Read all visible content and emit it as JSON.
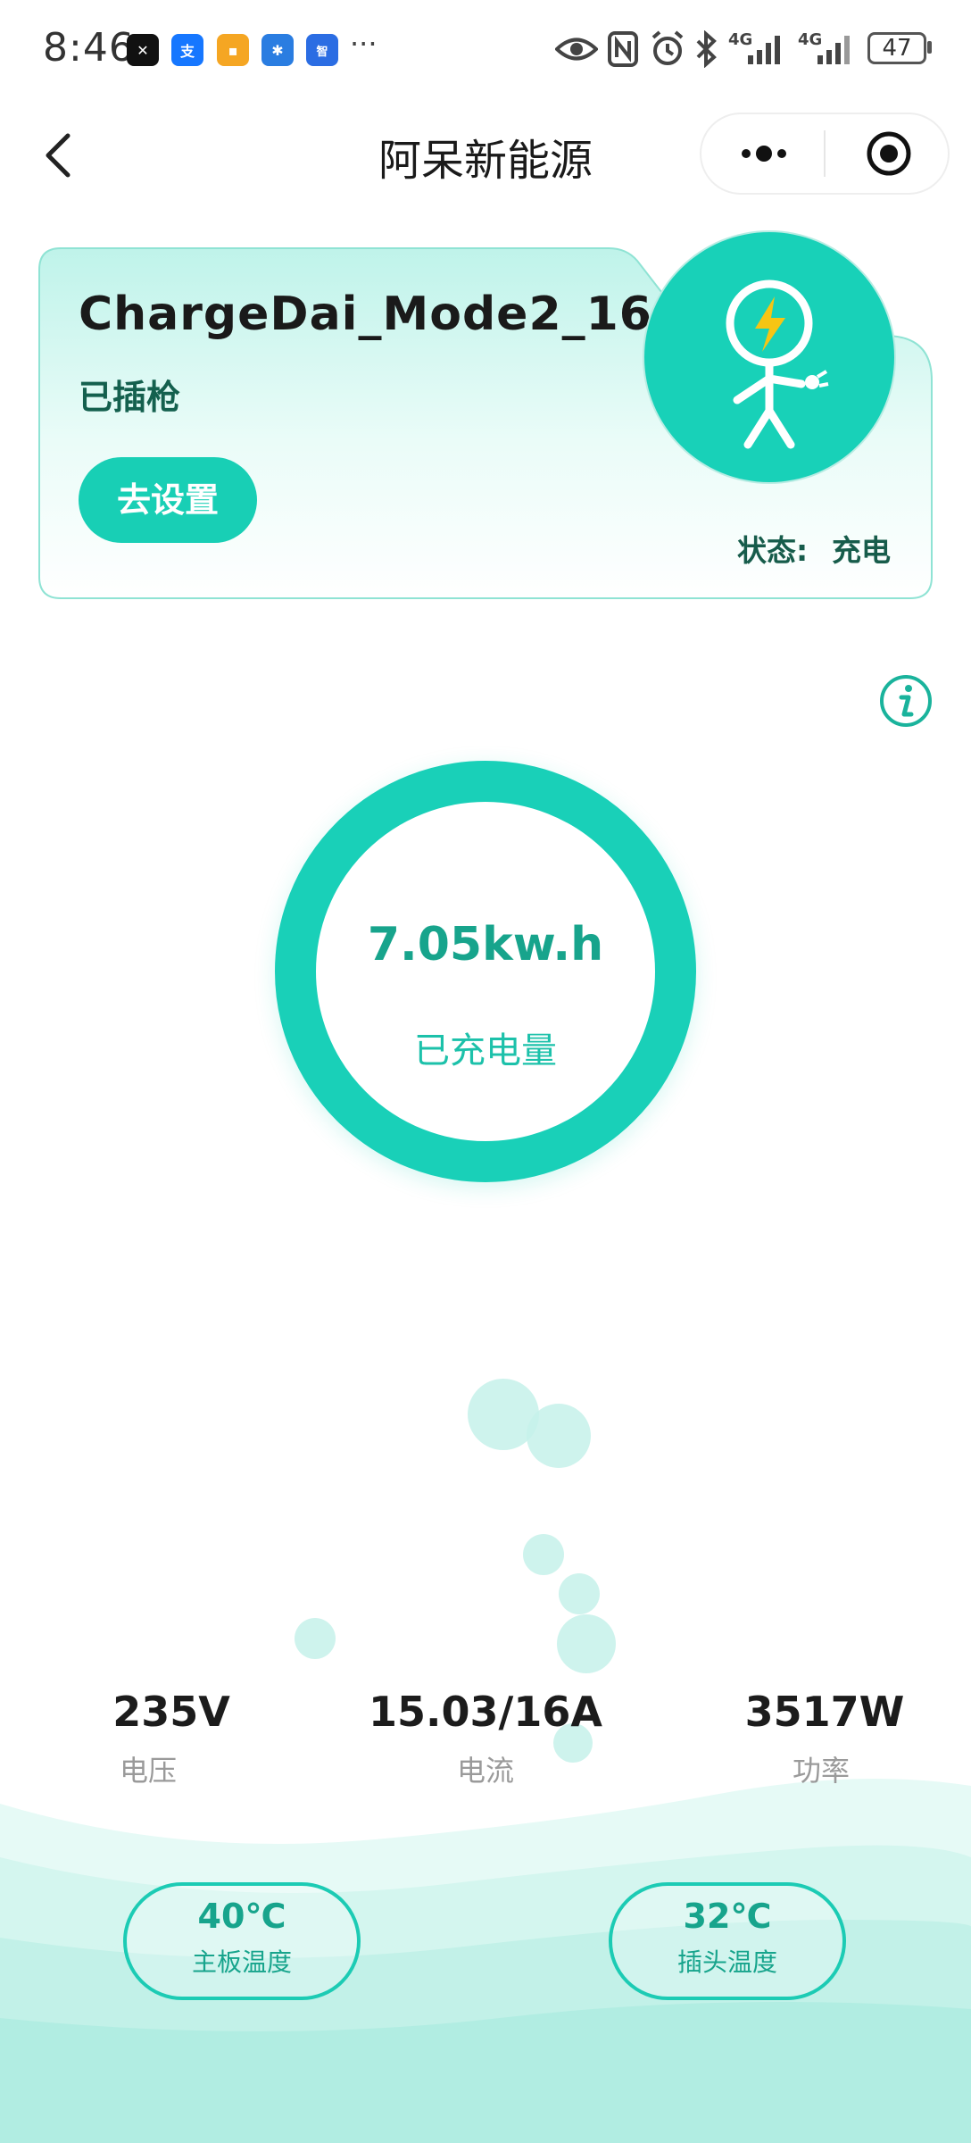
{
  "status_bar": {
    "time": "8:46",
    "more": "···",
    "network_1": "4G",
    "network_2": "4G",
    "battery": "47"
  },
  "nav": {
    "title": "阿呆新能源"
  },
  "device": {
    "name": "ChargeDai_Mode2_16A",
    "plug_status": "已插枪",
    "settings_button": "去设置",
    "state_label": "状态:",
    "state_value": "充电"
  },
  "charge": {
    "energy_value": "7.05kw.h",
    "energy_label": "已充电量"
  },
  "stats": [
    {
      "value": "235V",
      "label": "电压"
    },
    {
      "value": "15.03/16A",
      "label": "电流"
    },
    {
      "value": "3517W",
      "label": "功率"
    }
  ],
  "temps": [
    {
      "value": "40℃",
      "label": "主板温度"
    },
    {
      "value": "32℃",
      "label": "插头温度"
    }
  ],
  "colors": {
    "accent": "#19d0b8",
    "dark_text": "#175c4b",
    "accent_text": "#17a48c"
  }
}
